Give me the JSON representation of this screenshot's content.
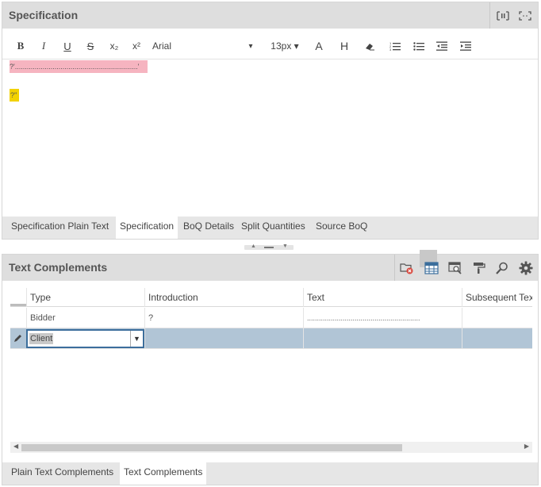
{
  "spec_panel": {
    "title": "Specification",
    "toolbar": {
      "bold": "B",
      "italic": "I",
      "underline": "U",
      "strike": "S",
      "subscript": "x₂",
      "superscript": "x²",
      "font": "Arial",
      "font_caret": "▾",
      "size": "13px ▾",
      "font_color": "A",
      "highlight": "H"
    },
    "editor": {
      "line1": "?'..............................................................'",
      "line2": "?''"
    },
    "tabs": [
      {
        "label": "Specification Plain Text",
        "active": false
      },
      {
        "label": "Specification",
        "active": true
      },
      {
        "label": "BoQ Details",
        "active": false
      },
      {
        "label": "Split Quantities",
        "active": false
      },
      {
        "label": "Source BoQ",
        "active": false
      }
    ]
  },
  "tc_panel": {
    "title": "Text Complements",
    "columns": [
      "Type",
      "Introduction",
      "Text",
      "Subsequent Text"
    ],
    "rows": [
      {
        "type": "Bidder",
        "introduction": "?",
        "text": ".........................................................",
        "subsequent": ""
      },
      {
        "type": "Client",
        "introduction": "",
        "text": "",
        "subsequent": ""
      }
    ],
    "tabs": [
      {
        "label": "Plain Text Complements",
        "active": false
      },
      {
        "label": "Text Complements",
        "active": true
      }
    ]
  },
  "colors": {
    "header_bg": "#dedede",
    "selected_row": "#b1c5d6",
    "pink_highlight": "#f6b4c0",
    "yellow_highlight": "#f2d200",
    "edit_border": "#3c6e9c"
  }
}
